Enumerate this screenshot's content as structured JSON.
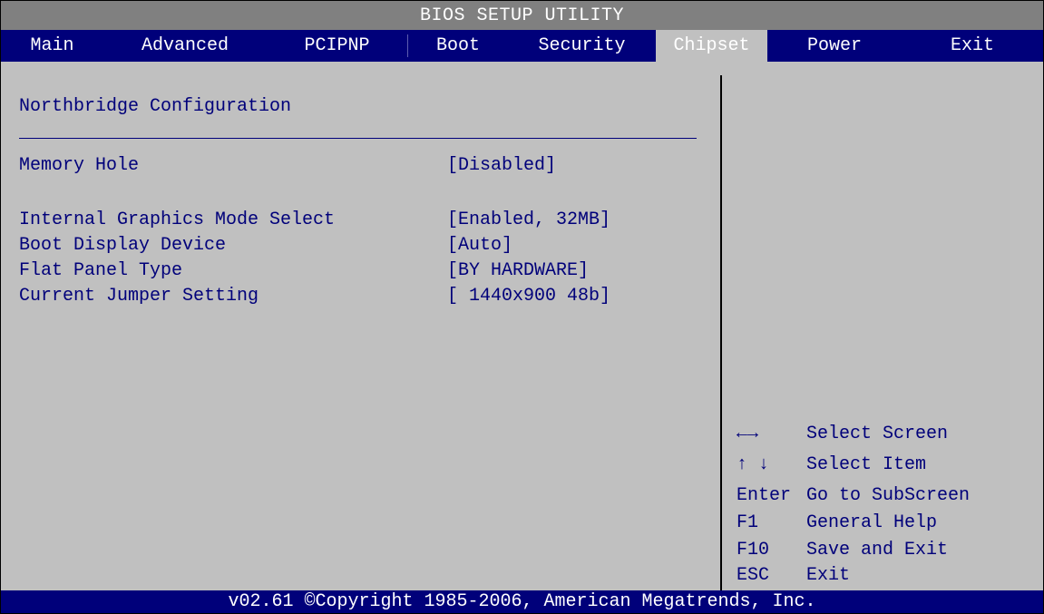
{
  "title": "BIOS SETUP UTILITY",
  "tabs": [
    {
      "label": "Main"
    },
    {
      "label": "Advanced"
    },
    {
      "label": "PCIPNP"
    },
    {
      "label": "Boot"
    },
    {
      "label": "Security"
    },
    {
      "label": "Chipset",
      "active": true
    },
    {
      "label": "Power"
    },
    {
      "label": "Exit"
    }
  ],
  "section": {
    "title": "Northbridge Configuration"
  },
  "settings": [
    {
      "label": "Memory Hole",
      "value": "[Disabled]"
    },
    {
      "label": "Internal Graphics Mode Select",
      "value": "[Enabled, 32MB]"
    },
    {
      "label": "Boot Display Device",
      "value": "[Auto]"
    },
    {
      "label": "Flat Panel Type",
      "value": "[BY HARDWARE]"
    },
    {
      "label": "Current Jumper Setting",
      "value": "[ 1440x900 48b]"
    }
  ],
  "help_keys": [
    {
      "key": "←→",
      "desc": "Select Screen"
    },
    {
      "key": "↑ ↓",
      "desc": "Select Item"
    },
    {
      "key": "Enter",
      "desc": "Go to SubScreen"
    },
    {
      "key": "F1",
      "desc": "General Help"
    },
    {
      "key": "F10",
      "desc": "Save and Exit"
    },
    {
      "key": "ESC",
      "desc": "Exit"
    }
  ],
  "footer": "v02.61 ©Copyright 1985-2006, American Megatrends, Inc.",
  "colors": {
    "blue": "#00007a",
    "gray": "#c0c0c0",
    "title_bg": "#808080"
  }
}
